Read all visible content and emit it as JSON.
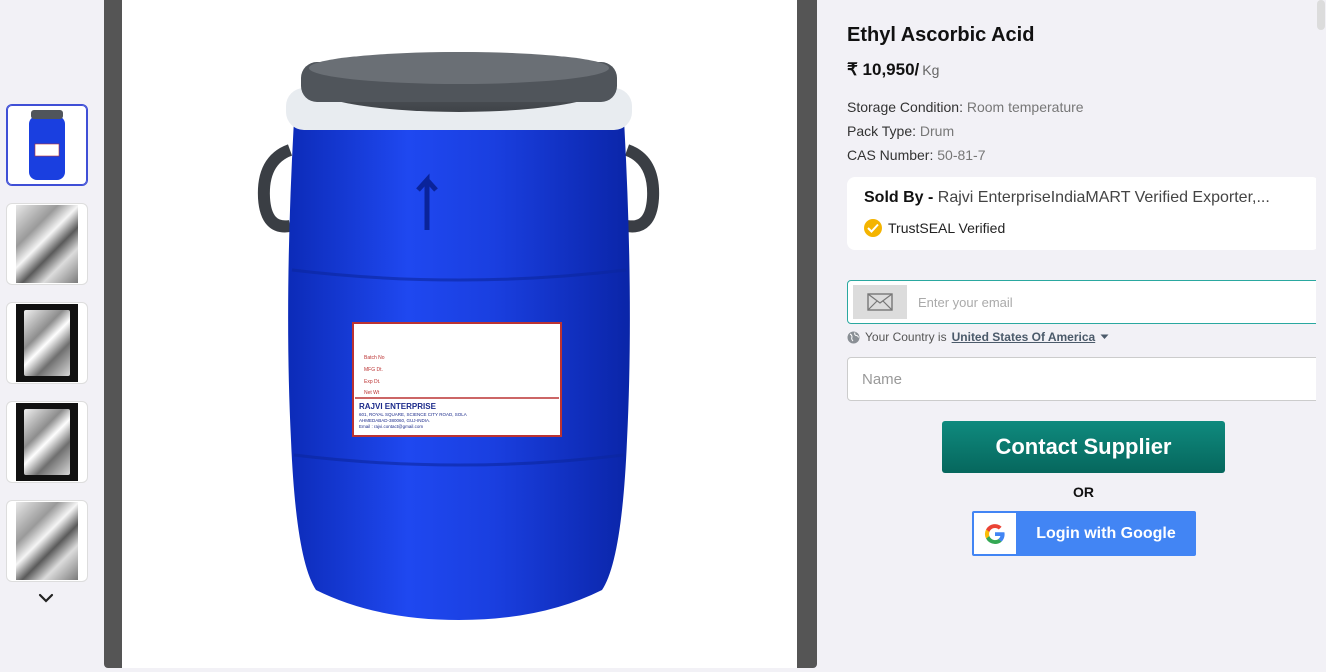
{
  "product": {
    "title": "Ethyl Ascorbic Acid",
    "price": "₹ 10,950/",
    "price_unit": "Kg",
    "specs": [
      {
        "label": "Storage Condition:",
        "value": "Room temperature"
      },
      {
        "label": "Pack Type:",
        "value": "Drum"
      },
      {
        "label": "CAS Number:",
        "value": "50-81-7"
      }
    ]
  },
  "seller": {
    "sold_by_label": "Sold By -",
    "name": "Rajvi EnterpriseIndiaMART Verified Exporter,...",
    "trust_badge": "TrustSEAL Verified"
  },
  "form": {
    "email_placeholder": "Enter your email",
    "country_prefix": "Your Country is",
    "country": "United States Of America",
    "name_placeholder": "Name",
    "contact_button": "Contact Supplier",
    "or_text": "OR",
    "google_button": "Login with Google"
  },
  "drum_label": {
    "fields": [
      "Batch No",
      "MFG Dt.",
      "Exp Dt.",
      "Net Wt"
    ],
    "company": "RAJVI ENTERPRISE",
    "address1": "601, ROYAL SQUARE, SCIENCE CITY ROAD, SOLA",
    "address2": "AHMEDABAD-380060, GUJ-INDIA.",
    "email": "Email : rajvi.contact@gmail.com"
  },
  "colors": {
    "drum_blue": "#1a3fe0",
    "lid_gray": "#555a60",
    "contact_green": "#0a7a6f",
    "google_blue": "#4285f4",
    "accent_teal": "#2aa8a0"
  },
  "icons": [
    "chevron-down-icon",
    "mail-icon",
    "globe-icon",
    "caret-down-icon",
    "trustseal-icon",
    "google-g-icon"
  ]
}
